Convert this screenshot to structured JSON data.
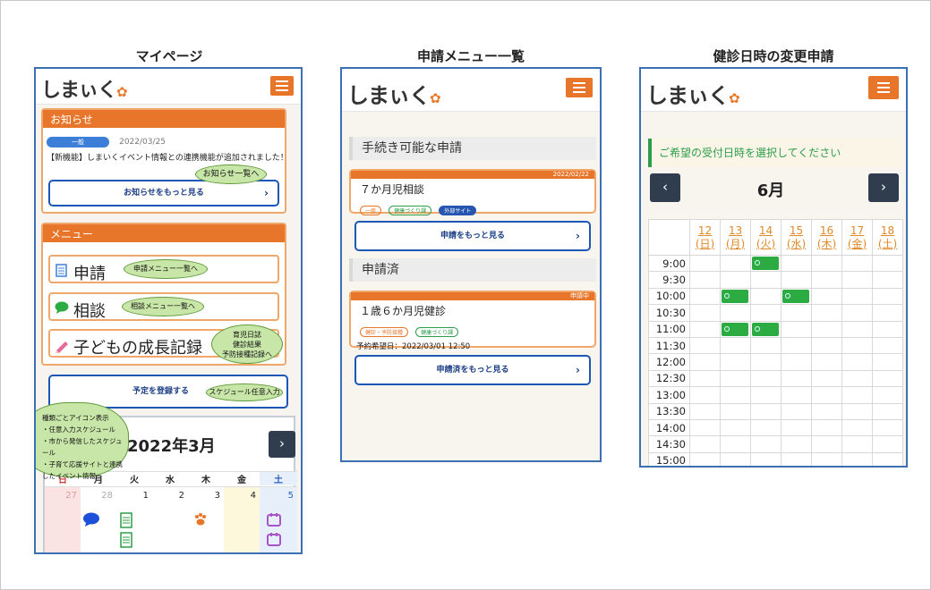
{
  "titles": {
    "my_page": "マイページ",
    "menu_list": "申請メニュー一覧",
    "change_request": "健診日時の変更申請"
  },
  "app": {
    "logo_text": "しまぃく",
    "logo_flower": "✿"
  },
  "mypage": {
    "news": {
      "header": "お知らせ",
      "badge": "一般",
      "date": "2022/03/25",
      "text": "【新機能】しまいくイベント情報との連携機能が追加されました！",
      "more_button": "お知らせをもっと見る",
      "bubble": "お知らせ一覧へ"
    },
    "menu": {
      "header": "メニュー",
      "items": [
        {
          "label": "申請",
          "bubble": "申請メニュー一覧へ"
        },
        {
          "label": "相談",
          "bubble": "相談メニュー一覧へ"
        },
        {
          "label": "子どもの成長記録",
          "bubble_lines": [
            "育児日誌",
            "健診結果",
            "予防接種記録へ"
          ]
        }
      ]
    },
    "schedule_button": "予定を登録する",
    "schedule_bubble": "スケジュール任意入力",
    "calendar_bubble_lines": [
      "種類ごとアイコン表示",
      "・任意入力スケジュール",
      "・市から発信したスケジュール",
      "・子育て応援サイトと連携",
      "したイベント情報"
    ],
    "calendar": {
      "month": "2022年3月",
      "weekdays": [
        "日",
        "月",
        "火",
        "水",
        "木",
        "金",
        "土"
      ],
      "days": [
        "27",
        "28",
        "1",
        "2",
        "3",
        "4",
        "5"
      ]
    }
  },
  "menu_page": {
    "section_available": "手続き可能な申請",
    "card1": {
      "date": "2022/02/22",
      "title": "７か月児相談",
      "tags": [
        "一般",
        "健康づくり課",
        "外部サイト"
      ]
    },
    "more_requests": "申請をもっと見る",
    "section_applied": "申請済",
    "card2": {
      "status": "申請中",
      "title": "１歳６か月児健診",
      "tags": [
        "健診・予防接種",
        "健康づくり課"
      ],
      "desired_date": "予約希望日：2022/03/01 12:50"
    },
    "more_applied": "申請済をもっと見る"
  },
  "change_page": {
    "notice": "ご希望の受付日時を選択してください",
    "month": "6月",
    "dates": [
      {
        "day": "12",
        "weekday": "(日)"
      },
      {
        "day": "13",
        "weekday": "(月)"
      },
      {
        "day": "14",
        "weekday": "(火)"
      },
      {
        "day": "15",
        "weekday": "(水)"
      },
      {
        "day": "16",
        "weekday": "(木)"
      },
      {
        "day": "17",
        "weekday": "(金)"
      },
      {
        "day": "18",
        "weekday": "(土)"
      }
    ],
    "times": [
      "9:00",
      "9:30",
      "10:00",
      "10:30",
      "11:00",
      "11:30",
      "12:00",
      "12:30",
      "13:00",
      "13:30",
      "14:00",
      "14:30",
      "15:00"
    ],
    "available_slots": [
      [
        0,
        2
      ],
      [
        2,
        1
      ],
      [
        2,
        3
      ],
      [
        4,
        1
      ],
      [
        4,
        2
      ]
    ]
  },
  "colors": {
    "accent": "#e8762a",
    "border_blue": "#3d6fb4",
    "slot_green": "#2cab43",
    "notice_green": "#2c9d4a"
  }
}
